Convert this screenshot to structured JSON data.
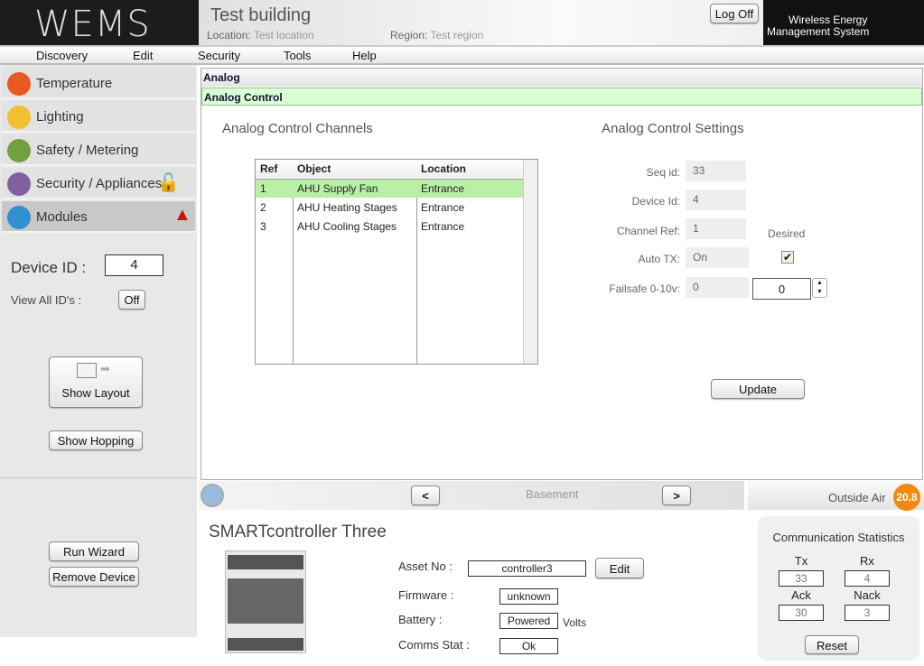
{
  "header": {
    "logo": "WEMS",
    "building": "Test building",
    "location_label": "Location:",
    "location": "Test location",
    "region_label": "Region:",
    "region": "Test region",
    "logoff": "Log Off",
    "brand_line1": "Wireless Energy",
    "brand_line2": "Management System"
  },
  "menu": [
    "Discovery",
    "Edit",
    "Security",
    "Tools",
    "Help"
  ],
  "sidebar": {
    "items": [
      {
        "label": "Temperature",
        "color": "#e85a20"
      },
      {
        "label": "Lighting",
        "color": "#f0c030"
      },
      {
        "label": "Safety / Metering",
        "color": "#70a040"
      },
      {
        "label": "Security / Appliances",
        "color": "#8060a0"
      },
      {
        "label": "Modules",
        "color": "#3090d0"
      }
    ],
    "device_id_label": "Device ID :",
    "device_id": "4",
    "view_all_label": "View All ID's :",
    "view_all": "Off",
    "show_layout": "Show Layout",
    "show_hopping": "Show Hopping",
    "run_wizard": "Run Wizard",
    "remove_device": "Remove Device"
  },
  "main": {
    "bar1": "Analog",
    "bar2": "Analog Control",
    "channels_title": "Analog Control Channels",
    "settings_title": "Analog Control Settings",
    "columns": [
      "Ref",
      "Object",
      "Location"
    ],
    "rows": [
      [
        "1",
        "AHU Supply Fan",
        "Entrance"
      ],
      [
        "2",
        "AHU Heating Stages",
        "Entrance"
      ],
      [
        "3",
        "AHU Cooling Stages",
        "Entrance"
      ]
    ],
    "settings": {
      "seq_label": "Seq id:",
      "seq": "33",
      "device_label": "Device Id:",
      "device": "4",
      "channel_label": "Channel Ref:",
      "channel": "1",
      "autotx_label": "Auto TX:",
      "autotx": "On",
      "failsafe_label": "Failsafe 0-10v:",
      "failsafe": "0",
      "desired_label": "Desired",
      "desired_checked": true,
      "desired_value": "0"
    },
    "update": "Update"
  },
  "nav": {
    "prev": "<",
    "next": ">",
    "floor": "Basement",
    "outside_label": "Outside Air",
    "outside_value": "20.8"
  },
  "device": {
    "title": "SMARTcontroller Three",
    "asset_label": "Asset No :",
    "asset": "controller3",
    "edit": "Edit",
    "firmware_label": "Firmware :",
    "firmware": "unknown",
    "battery_label": "Battery :",
    "battery": "Powered",
    "battery_unit": "Volts",
    "comms_label": "Comms Stat :",
    "comms": "Ok"
  },
  "stats": {
    "title": "Communication Statistics",
    "tx_label": "Tx",
    "tx": "33",
    "rx_label": "Rx",
    "rx": "4",
    "ack_label": "Ack",
    "ack": "30",
    "nack_label": "Nack",
    "nack": "3",
    "reset": "Reset"
  }
}
